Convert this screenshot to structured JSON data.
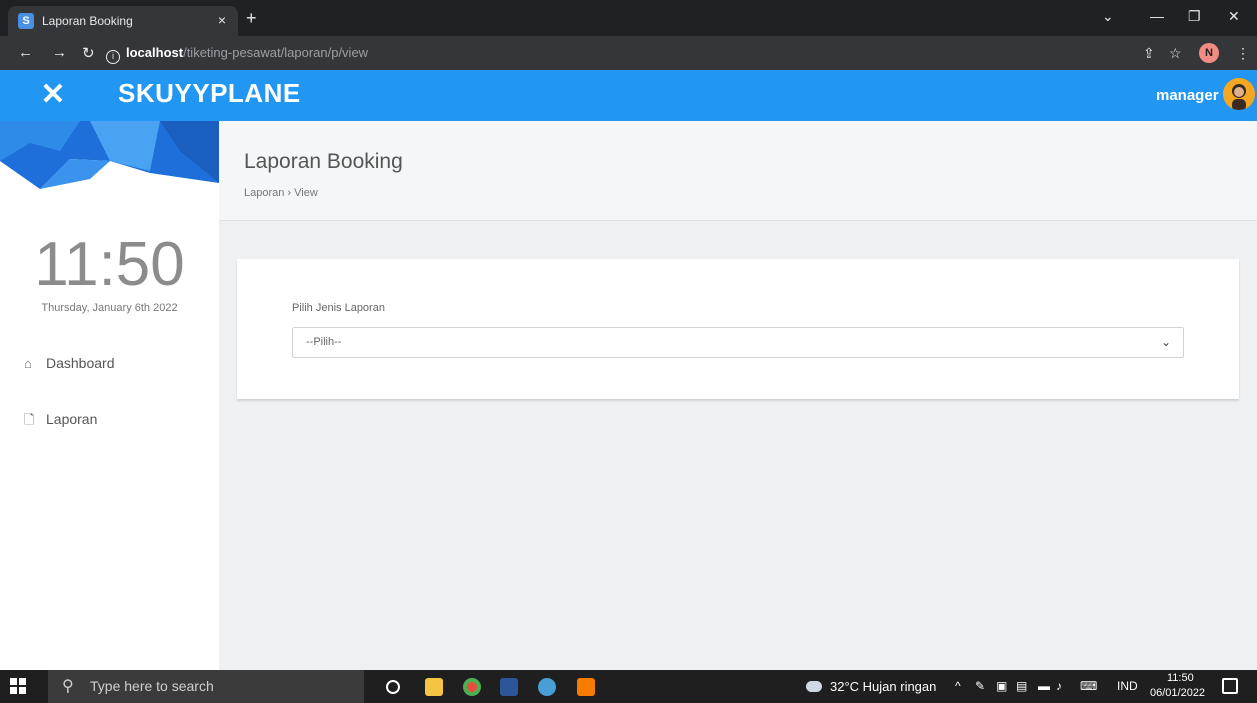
{
  "browser": {
    "tab_title": "Laporan Booking",
    "tab_close": "×",
    "new_tab": "+",
    "url_host": "localhost",
    "url_path": "/tiketing-pesawat/laporan/p/view",
    "profile_initial": "N"
  },
  "header": {
    "brand": "SKUYYPLANE",
    "username": "manager",
    "close_glyph": "✕"
  },
  "sidebar": {
    "clock": "11:50",
    "date": "Thursday, January 6th 2022",
    "items": [
      {
        "label": "Dashboard"
      },
      {
        "label": "Laporan"
      }
    ]
  },
  "page": {
    "title": "Laporan Booking",
    "breadcrumb": "Laporan › View"
  },
  "form": {
    "label": "Pilih Jenis Laporan",
    "select_value": "--Pilih--"
  },
  "taskbar": {
    "search_placeholder": "Type here to search",
    "weather": "32°C  Hujan ringan",
    "lang": "IND",
    "time": "11:50",
    "date": "06/01/2022"
  },
  "colors": {
    "header_blue": "#2196f3",
    "sidebar_bg": "#ffffff",
    "content_bg": "#eef0f1"
  }
}
